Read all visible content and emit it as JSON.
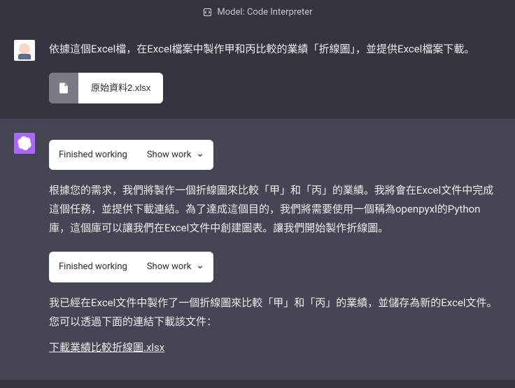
{
  "header": {
    "model_label": "Model: Code Interpreter"
  },
  "user_message": {
    "text": "依據這個Excel檔，在Excel檔案中製作甲和丙比較的業績「折線圖」，並提供Excel檔案下載。",
    "attachment": {
      "filename": "原始資料2.xlsx"
    }
  },
  "assistant_message": {
    "finished1": {
      "status": "Finished working",
      "show_work": "Show work"
    },
    "para1": "根據您的需求，我們將製作一個折線圖來比較「甲」和「丙」的業績。我將會在Excel文件中完成這個任務，並提供下載連結。為了達成這個目的，我們將需要使用一個稱為openpyxl的Python庫，這個庫可以讓我們在Excel文件中創建圖表。讓我們開始製作折線圖。",
    "finished2": {
      "status": "Finished working",
      "show_work": "Show work"
    },
    "para2": "我已經在Excel文件中製作了一個折線圖來比較「甲」和「丙」的業績，並儲存為新的Excel文件。您可以透過下面的連結下載該文件：",
    "download_link": "下載業績比較折線圖.xlsx"
  }
}
